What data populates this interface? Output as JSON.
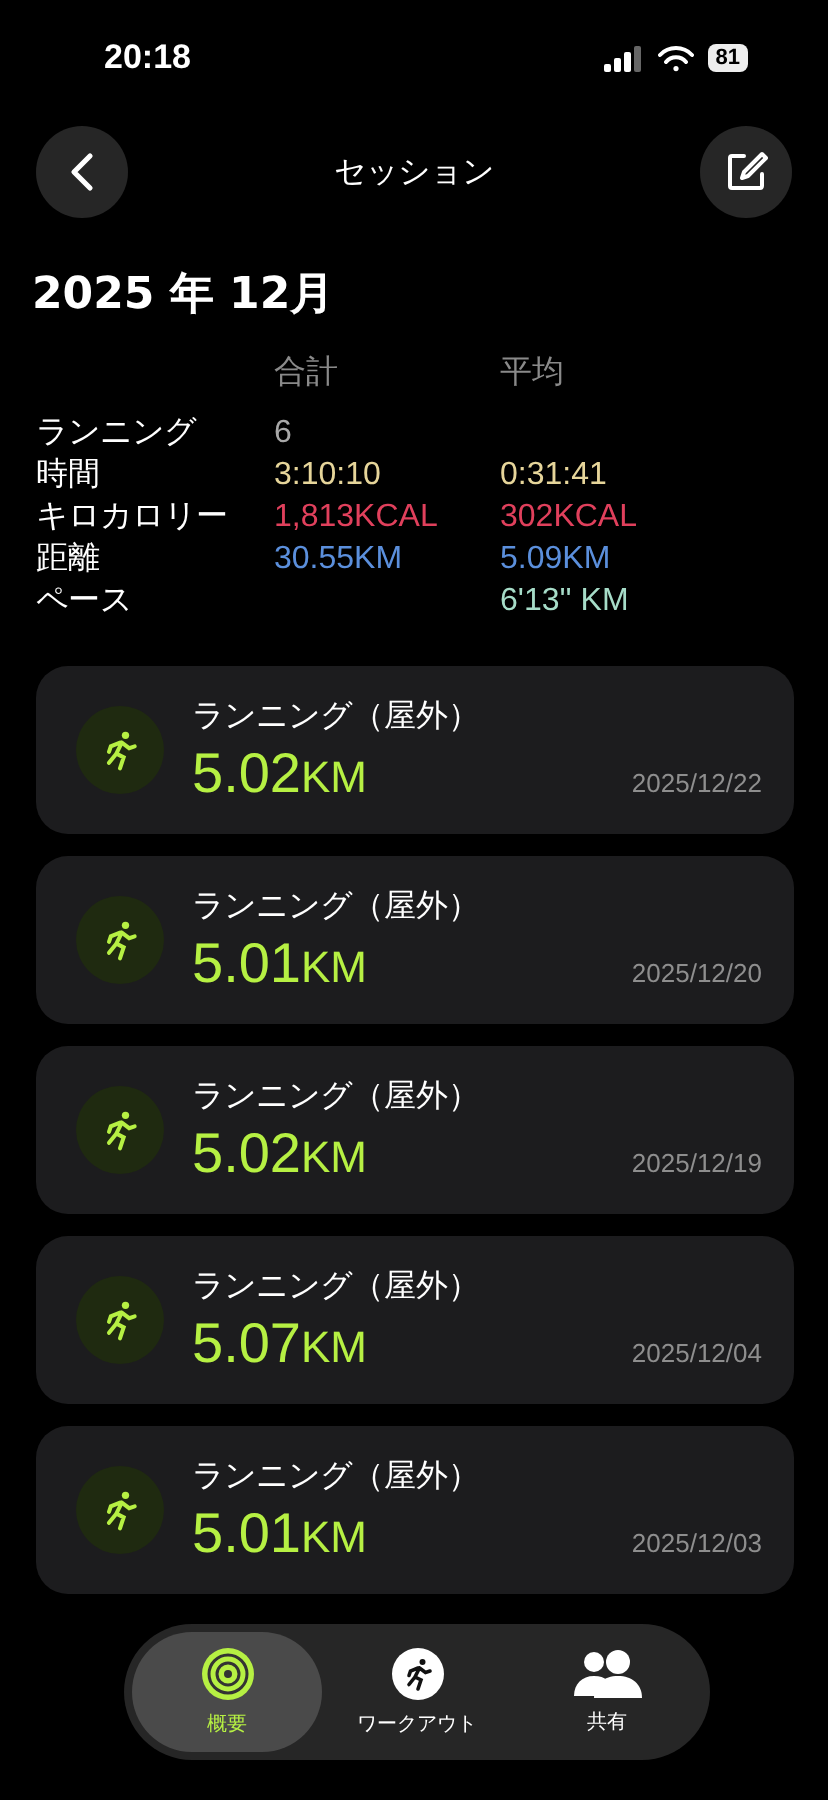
{
  "status_bar": {
    "time": "20:18",
    "battery": "81"
  },
  "header": {
    "title": "セッション"
  },
  "month": "2025 年 12月",
  "summary": {
    "columns": [
      "合計",
      "平均"
    ],
    "rows": [
      {
        "label": "ランニング",
        "total": "6",
        "average": "",
        "color": "#a8a8a8"
      },
      {
        "label": "時間",
        "total": "3:10:10",
        "average": "0:31:41",
        "color": "#e6d59a"
      },
      {
        "label": "キロカロリー",
        "total": "1,813KCAL",
        "average": "302KCAL",
        "color": "#e0405c"
      },
      {
        "label": "距離",
        "total": "30.55KM",
        "average": "5.09KM",
        "color": "#5b8fdc"
      },
      {
        "label": "ペース",
        "total": "",
        "average": "6'13'' KM",
        "color": "#a6dcc8"
      }
    ]
  },
  "sessions": [
    {
      "type": "ランニング（屋外）",
      "distance": "5.02",
      "unit": "KM",
      "date": "2025/12/22"
    },
    {
      "type": "ランニング（屋外）",
      "distance": "5.01",
      "unit": "KM",
      "date": "2025/12/20"
    },
    {
      "type": "ランニング（屋外）",
      "distance": "5.02",
      "unit": "KM",
      "date": "2025/12/19"
    },
    {
      "type": "ランニング（屋外）",
      "distance": "5.07",
      "unit": "KM",
      "date": "2025/12/04"
    },
    {
      "type": "ランニング（屋外）",
      "distance": "5.01",
      "unit": "KM",
      "date": "2025/12/03"
    }
  ],
  "tab_bar": [
    {
      "label": "概要",
      "kind": "summary",
      "selected": true
    },
    {
      "label": "ワークアウト",
      "kind": "workout",
      "selected": false
    },
    {
      "label": "共有",
      "kind": "sharing",
      "selected": false
    }
  ]
}
